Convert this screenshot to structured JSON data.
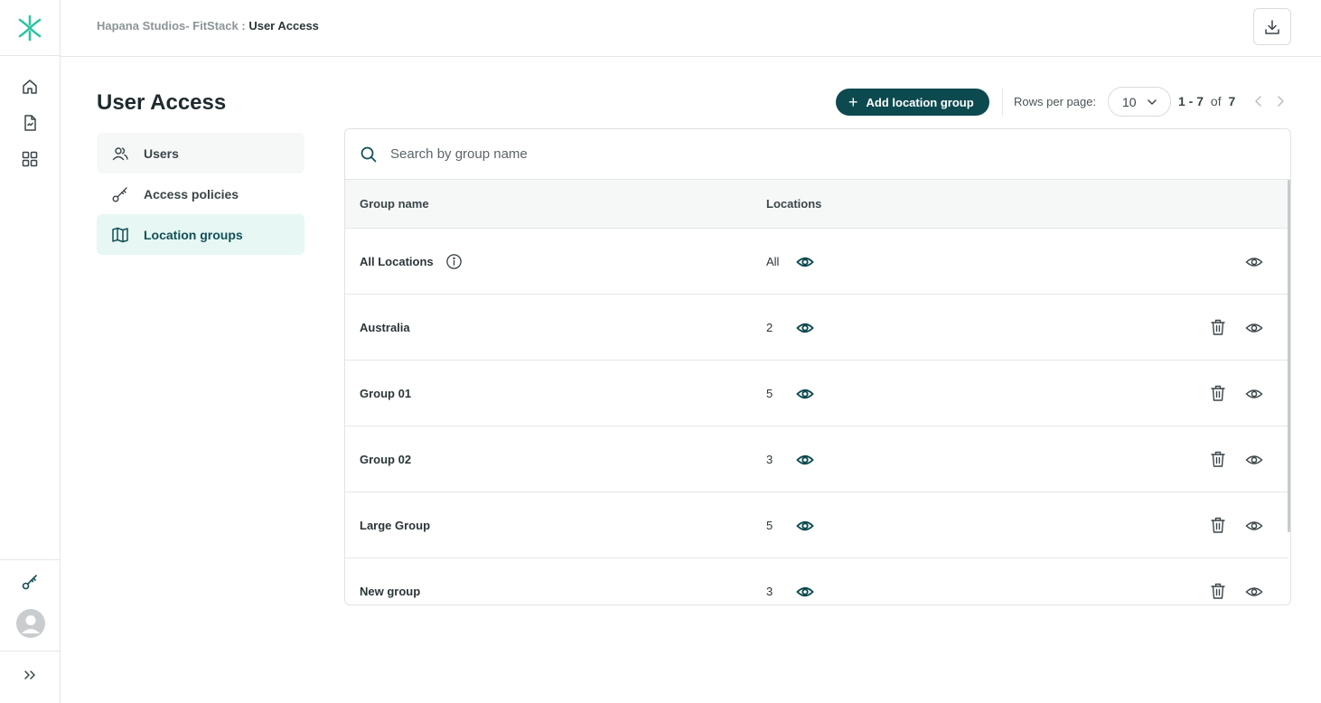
{
  "breadcrumb": {
    "org": "Hapana Studios- FitStack :",
    "current": "User Access"
  },
  "page": {
    "title": "User Access"
  },
  "subnav": {
    "items": [
      {
        "label": "Users",
        "icon": "users-icon"
      },
      {
        "label": "Access policies",
        "icon": "key-icon"
      },
      {
        "label": "Location groups",
        "icon": "map-icon"
      }
    ],
    "active": "Location groups"
  },
  "toolbar": {
    "add_label": "Add location group",
    "rows_per_page_label": "Rows per page:",
    "rows_per_page_value": "10",
    "range": "1 - 7",
    "of_label": "of",
    "total": "7"
  },
  "search": {
    "placeholder": "Search by group name"
  },
  "table": {
    "columns": [
      "Group name",
      "Locations"
    ],
    "rows": [
      {
        "name": "All Locations",
        "locations": "All",
        "info": true,
        "deletable": false
      },
      {
        "name": "Australia",
        "locations": "2",
        "deletable": true
      },
      {
        "name": "Group 01",
        "locations": "5",
        "deletable": true
      },
      {
        "name": "Group 02",
        "locations": "3",
        "deletable": true
      },
      {
        "name": "Large Group",
        "locations": "5",
        "deletable": true
      },
      {
        "name": "New group",
        "locations": "3",
        "deletable": true
      }
    ]
  },
  "colors": {
    "brand": "#0d4a4f",
    "accent": "#2fc4a2",
    "active_bg": "#e6f7f4",
    "icon": "#124f55"
  }
}
